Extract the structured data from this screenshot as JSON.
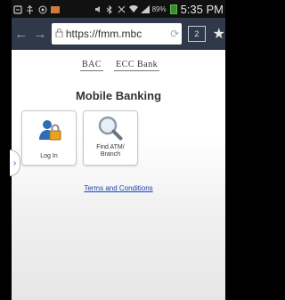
{
  "status_bar": {
    "battery": "89%",
    "time": "5:35 PM"
  },
  "browser": {
    "url": "https://fmm.mbc",
    "tab_count": "2",
    "back_icon": "arrow-left-icon",
    "forward_icon": "arrow-right-icon"
  },
  "page": {
    "logo_left": "BAC",
    "logo_right": "ECC Bank",
    "title": "Mobile Banking",
    "tiles": [
      {
        "label": "Log In",
        "icon": "padlock-user-icon"
      },
      {
        "label_line1": "Find ATM/",
        "label_line2": "Branch",
        "icon": "magnifier-icon"
      }
    ],
    "terms_link": "Terms and Conditions"
  }
}
